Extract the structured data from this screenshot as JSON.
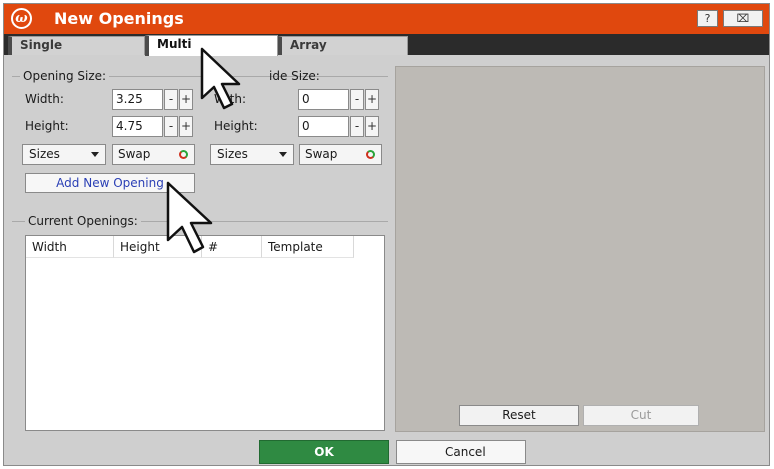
{
  "window": {
    "title": "New Openings",
    "logo_glyph": "ω"
  },
  "title_buttons": {
    "help_glyph": "?",
    "close_glyph": "⌧"
  },
  "tabs": [
    {
      "label": "Single",
      "active": false
    },
    {
      "label": "Multi",
      "active": true
    },
    {
      "label": "Array",
      "active": false
    }
  ],
  "opening_size": {
    "legend": "Opening Size:",
    "width_label": "Width:",
    "width_value": "3.25",
    "height_label": "Height:",
    "height_value": "4.75",
    "sizes_label": "Sizes",
    "swap_label": "Swap"
  },
  "inside_size": {
    "legend": "Inside Size:",
    "legend_visible": "ide Size:",
    "width_label": "Width:",
    "width_visible": "W   th:",
    "width_value": "0",
    "height_label": "Height:",
    "height_value": "0",
    "sizes_label": "Sizes",
    "swap_label": "Swap"
  },
  "stepper": {
    "minus": "-",
    "plus": "+"
  },
  "add_opening_label": "Add New Opening",
  "current_openings": {
    "legend": "Current Openings:",
    "columns": [
      "Width",
      "Height",
      "#",
      "Template"
    ]
  },
  "preview": {
    "reset_label": "Reset",
    "cut_label": "Cut"
  },
  "footer": {
    "ok_label": "OK",
    "cancel_label": "Cancel"
  },
  "colors": {
    "title_bar": "#e0480e",
    "ok_button": "#2f8a42",
    "link_text": "#2a3fb5"
  },
  "icons": [
    "app-logo-icon",
    "help-icon",
    "close-icon",
    "dropdown-caret-icon",
    "swap-icon",
    "mouse-cursor-icon"
  ]
}
